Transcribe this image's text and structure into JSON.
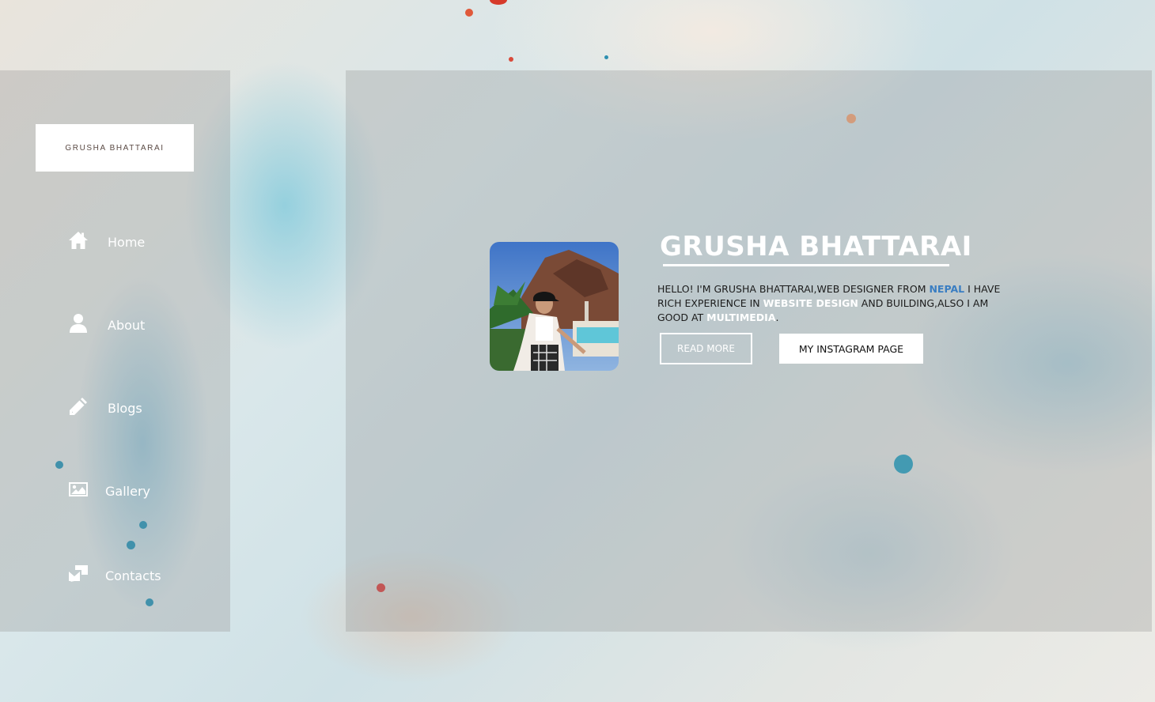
{
  "logo": {
    "text": "GRUSHA BHATTARAI"
  },
  "nav": [
    {
      "label": "Home",
      "icon": "home-icon"
    },
    {
      "label": "About",
      "icon": "user-icon"
    },
    {
      "label": "Blogs",
      "icon": "pencil-icon"
    },
    {
      "label": "Gallery",
      "icon": "image-icon"
    },
    {
      "label": "Contacts",
      "icon": "contacts-icon"
    }
  ],
  "hero": {
    "name": "GRUSHA BHATTARAI",
    "intro": {
      "part1": "HELLO! I'M GRUSHA BHATTARAI,WEB DESIGNER FROM ",
      "country": "NEPAL",
      "part2": " I HAVE RICH EXPERIENCE IN ",
      "skill1": "WEBSITE DESIGN",
      "part3": " AND BUILDING,ALSO I AM GOOD AT ",
      "skill2": "MULTIMEDIA",
      "part4": "."
    },
    "buttons": {
      "read_more": "READ MORE",
      "instagram": "MY INSTAGRAM PAGE"
    }
  },
  "colors": {
    "panel_overlay": "#969696",
    "accent_blue": "#3a7ec2",
    "text_white": "#ffffff"
  }
}
